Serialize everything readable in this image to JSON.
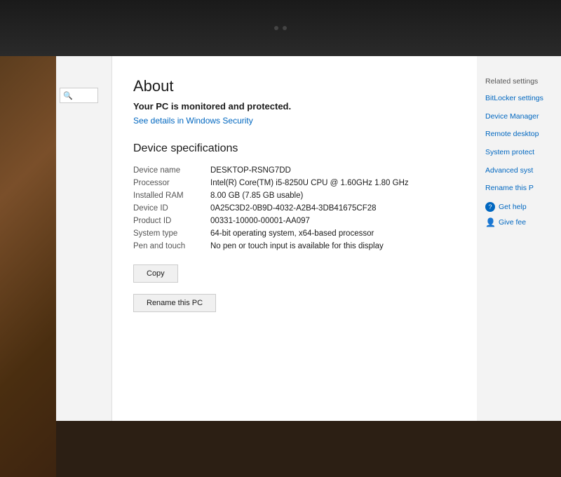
{
  "bezel": {
    "camera_dots": 2
  },
  "sidebar": {
    "search_placeholder": ""
  },
  "main": {
    "title": "About",
    "security_status": "Your PC is monitored and protected.",
    "security_link": "See details in Windows Security",
    "device_section_title": "Device specifications",
    "specs": [
      {
        "label": "Device name",
        "value": "DESKTOP-RSNG7DD"
      },
      {
        "label": "Processor",
        "value": "Intel(R) Core(TM) i5-8250U CPU @ 1.60GHz   1.80 GHz"
      },
      {
        "label": "Installed RAM",
        "value": "8.00 GB (7.85 GB usable)"
      },
      {
        "label": "Device ID",
        "value": "0A25C3D2-0B9D-4032-A2B4-3DB41675CF28"
      },
      {
        "label": "Product ID",
        "value": "00331-10000-00001-AA097"
      },
      {
        "label": "System type",
        "value": "64-bit operating system, x64-based processor"
      },
      {
        "label": "Pen and touch",
        "value": "No pen or touch input is available for this display"
      }
    ],
    "copy_button": "Copy",
    "rename_button": "Rename this PC"
  },
  "right_panel": {
    "heading": "Related settings",
    "links": [
      "BitLocker settings",
      "Device Manager",
      "Remote desktop",
      "System protect",
      "Advanced syst",
      "Rename this P"
    ],
    "get_help_label": "Get help",
    "give_feedback_label": "Give fee"
  }
}
